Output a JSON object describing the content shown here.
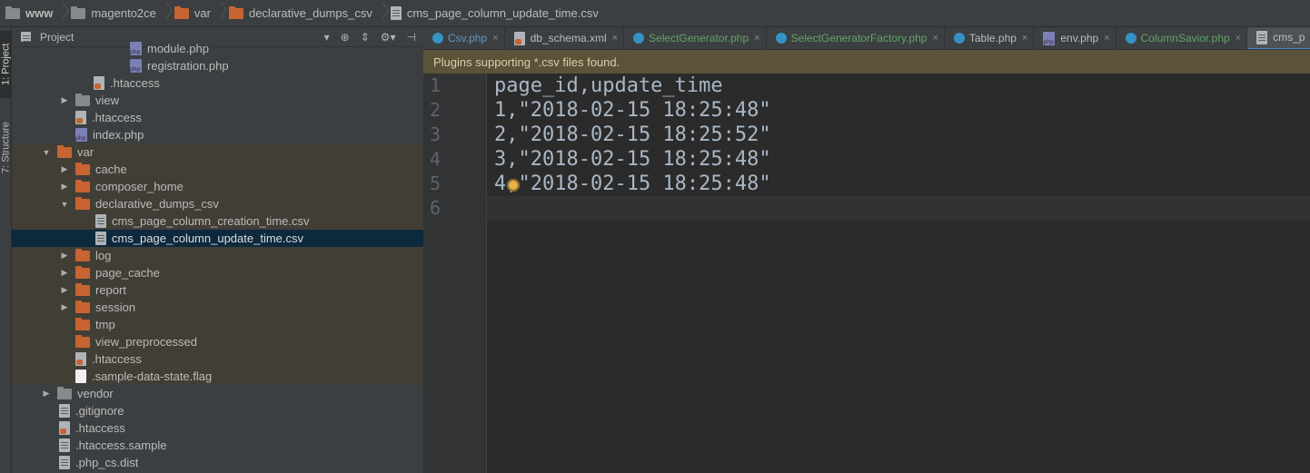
{
  "breadcrumb": [
    "www",
    "magento2ce",
    "var",
    "declarative_dumps_csv",
    "cms_page_column_update_time.csv"
  ],
  "toolstrip": {
    "project_tab": "1: Project",
    "structure_tab": "7: Structure"
  },
  "project_panel": {
    "title": "Project"
  },
  "tree": [
    {
      "label": "module.php",
      "icon": "php-file-icon",
      "indent": 130
    },
    {
      "label": "registration.php",
      "icon": "php-file-icon",
      "indent": 130
    },
    {
      "label": ".htaccess",
      "icon": "htaccess-icon",
      "indent": 90
    },
    {
      "label": "view",
      "icon": "gray-folder-icon",
      "indent": 52,
      "arrow": "right"
    },
    {
      "label": ".htaccess",
      "icon": "htaccess-icon",
      "indent": 70
    },
    {
      "label": "index.php",
      "icon": "php-file-icon",
      "indent": 70
    },
    {
      "label": "var",
      "icon": "orange-folder-icon",
      "indent": 32,
      "arrow": "down",
      "hl": true
    },
    {
      "label": "cache",
      "icon": "orange-folder-icon",
      "indent": 52,
      "arrow": "right",
      "hl": true
    },
    {
      "label": "composer_home",
      "icon": "orange-folder-icon",
      "indent": 52,
      "arrow": "right",
      "hl": true
    },
    {
      "label": "declarative_dumps_csv",
      "icon": "orange-folder-icon",
      "indent": 52,
      "arrow": "down",
      "hl": true
    },
    {
      "label": "cms_page_column_creation_time.csv",
      "icon": "text-file-icon",
      "indent": 92,
      "hl": true
    },
    {
      "label": "cms_page_column_update_time.csv",
      "icon": "text-file-icon",
      "indent": 92,
      "sel": true
    },
    {
      "label": "log",
      "icon": "orange-folder-icon",
      "indent": 52,
      "arrow": "right",
      "hl": true
    },
    {
      "label": "page_cache",
      "icon": "orange-folder-icon",
      "indent": 52,
      "arrow": "right",
      "hl": true
    },
    {
      "label": "report",
      "icon": "orange-folder-icon",
      "indent": 52,
      "arrow": "right",
      "hl": true
    },
    {
      "label": "session",
      "icon": "orange-folder-icon",
      "indent": 52,
      "arrow": "right",
      "hl": true
    },
    {
      "label": "tmp",
      "icon": "orange-folder-icon",
      "indent": 70,
      "hl": true
    },
    {
      "label": "view_preprocessed",
      "icon": "orange-folder-icon",
      "indent": 70,
      "hl": true
    },
    {
      "label": ".htaccess",
      "icon": "htaccess-icon",
      "indent": 70,
      "hl": true
    },
    {
      "label": ".sample-data-state.flag",
      "icon": "white-file-icon",
      "indent": 70,
      "hl": true
    },
    {
      "label": "vendor",
      "icon": "gray-folder-icon",
      "indent": 32,
      "arrow": "right"
    },
    {
      "label": ".gitignore",
      "icon": "text-file-icon",
      "indent": 52
    },
    {
      "label": ".htaccess",
      "icon": "htaccess-icon",
      "indent": 52
    },
    {
      "label": ".htaccess.sample",
      "icon": "text-file-icon",
      "indent": 52
    },
    {
      "label": ".php_cs.dist",
      "icon": "text-file-icon",
      "indent": 52
    }
  ],
  "tabs": [
    {
      "label": "Csv.php",
      "style": "modified"
    },
    {
      "label": "db_schema.xml",
      "style": "plain"
    },
    {
      "label": "SelectGenerator.php",
      "style": "mod2"
    },
    {
      "label": "SelectGeneratorFactory.php",
      "style": "mod2"
    },
    {
      "label": "Table.php",
      "style": "plain"
    },
    {
      "label": "env.php",
      "style": "plain"
    },
    {
      "label": "ColumnSavior.php",
      "style": "mod2"
    },
    {
      "label": "cms_p",
      "style": "active"
    }
  ],
  "notice": "Plugins supporting *.csv files found.",
  "code": {
    "line_numbers": [
      "1",
      "2",
      "3",
      "4",
      "5",
      "6"
    ],
    "lines": [
      "page_id,update_time",
      "1,\"2018-02-15 18:25:48\"",
      "2,\"2018-02-15 18:25:52\"",
      "3,\"2018-02-15 18:25:48\"",
      "4,\"2018-02-15 18:25:48\"",
      ""
    ]
  }
}
